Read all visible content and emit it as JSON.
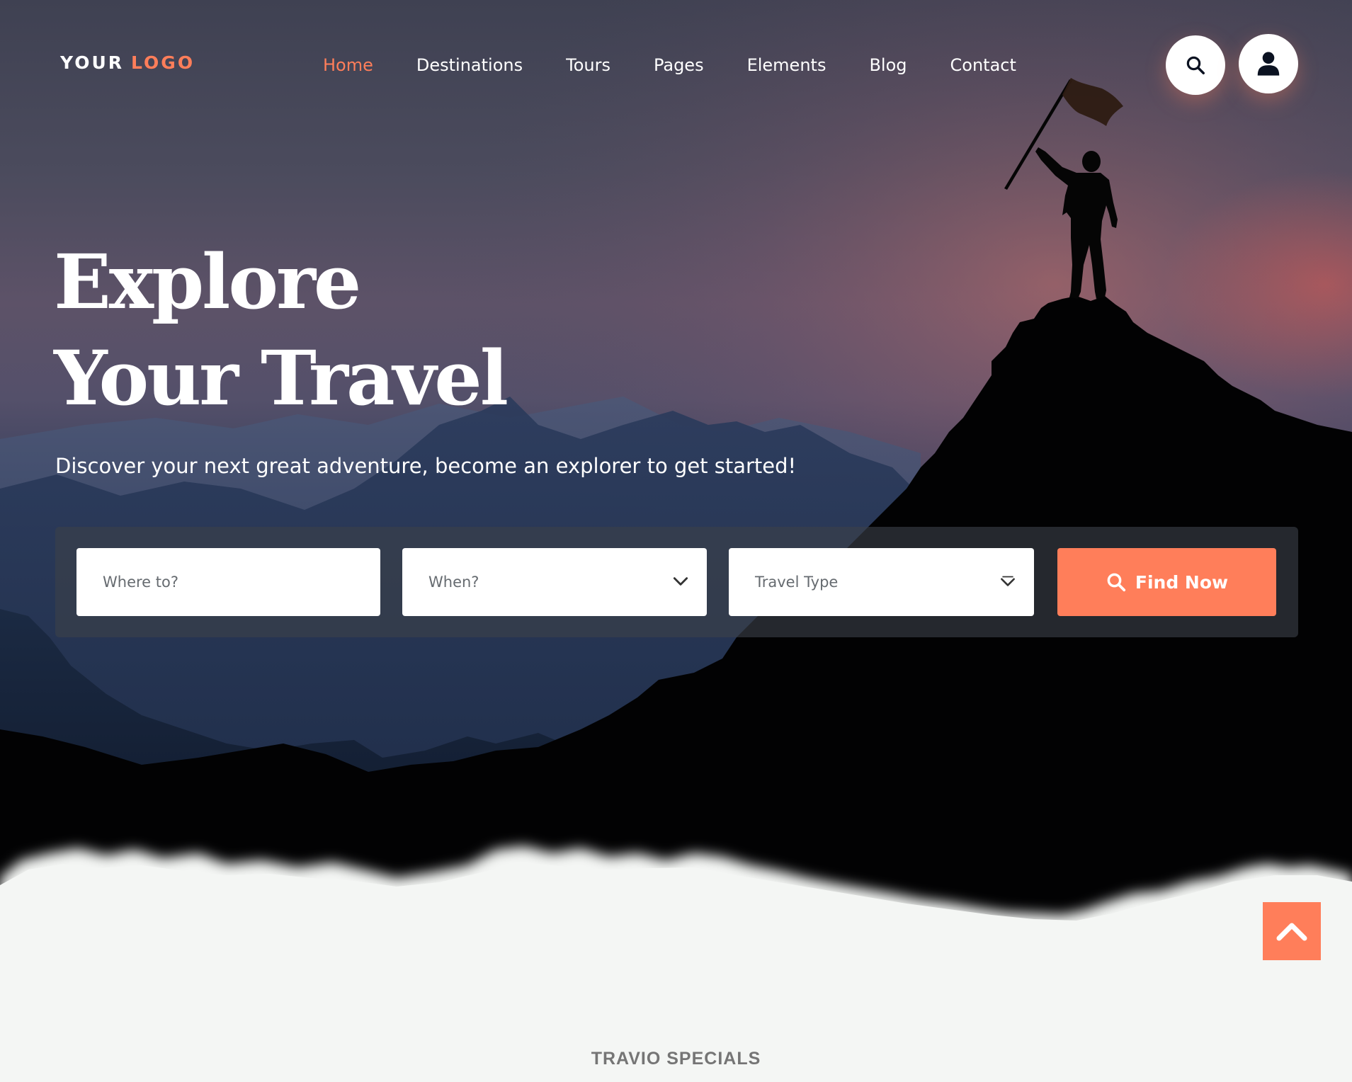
{
  "header": {
    "logo_part1": "YOUR",
    "logo_part2": "LOGO",
    "nav": [
      {
        "label": "Home",
        "active": true
      },
      {
        "label": "Destinations",
        "active": false
      },
      {
        "label": "Tours",
        "active": false
      },
      {
        "label": "Pages",
        "active": false
      },
      {
        "label": "Elements",
        "active": false
      },
      {
        "label": "Blog",
        "active": false
      },
      {
        "label": "Contact",
        "active": false
      }
    ],
    "search_icon": "search-icon",
    "user_icon": "user-icon"
  },
  "hero": {
    "title_line1": "Explore",
    "title_line2": "Your Travel",
    "subtitle": "Discover your next great adventure, become an explorer to get started!"
  },
  "search_form": {
    "where_placeholder": "Where to?",
    "when_placeholder": "When?",
    "type_placeholder": "Travel Type",
    "submit_label": "Find Now"
  },
  "section": {
    "kicker": "TRAVIO SPECIALS"
  },
  "colors": {
    "accent": "#ff7e5a",
    "white": "#ffffff",
    "page_bg": "#f4f6f4",
    "panel_bg": "rgba(60,64,72,0.62)"
  }
}
